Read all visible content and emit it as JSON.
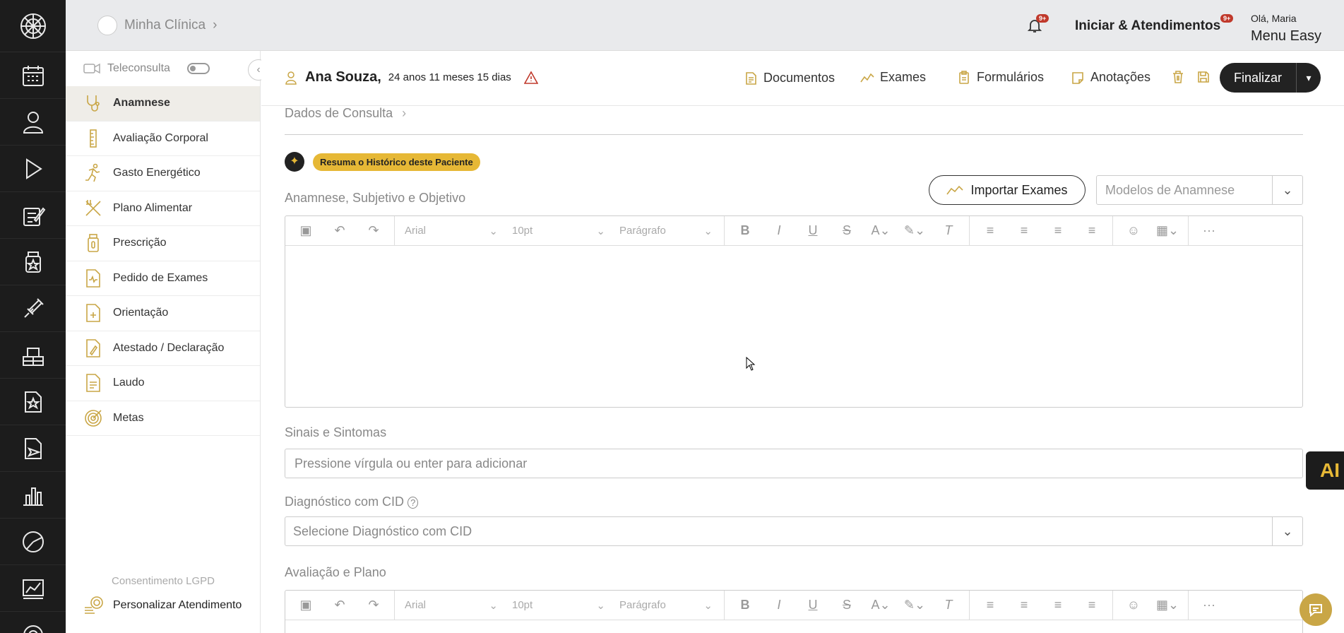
{
  "topbar": {
    "clinic_name": "Minha Clínica",
    "clinic_chevron": "›",
    "notif_badge": "9+",
    "start_label": "Iniciar & Atendimentos",
    "start_badge": "9+",
    "greeting": "Olá, Maria",
    "account_menu": "Menu Easy"
  },
  "rail": [
    "logo-icon",
    "calendar-icon",
    "patient-icon",
    "play-icon",
    "notes-icon",
    "bottle-icon",
    "syringe-icon",
    "boxes-icon",
    "star-document-icon",
    "send-document-icon",
    "chart-bars-icon",
    "chart-pie-icon",
    "finance-chart-icon",
    "settings-icon"
  ],
  "sidebar": {
    "teleconsulta": "Teleconsulta",
    "items": [
      {
        "label": "Anamnese",
        "icon": "stethoscope-icon",
        "active": true
      },
      {
        "label": "Avaliação Corporal",
        "icon": "ruler-icon"
      },
      {
        "label": "Gasto Energético",
        "icon": "running-icon"
      },
      {
        "label": "Plano Alimentar",
        "icon": "utensils-icon"
      },
      {
        "label": "Prescrição",
        "icon": "pill-bottle-icon"
      },
      {
        "label": "Pedido de Exames",
        "icon": "exam-document-icon"
      },
      {
        "label": "Orientação",
        "icon": "plus-document-icon"
      },
      {
        "label": "Atestado / Declaração",
        "icon": "sign-document-icon"
      },
      {
        "label": "Laudo",
        "icon": "report-icon"
      },
      {
        "label": "Metas",
        "icon": "target-icon"
      }
    ],
    "lgpd": "Consentimento LGPD",
    "customize": "Personalizar Atendimento"
  },
  "patient": {
    "name": "Ana Souza,",
    "age": "24 anos 11 meses 15 dias"
  },
  "actions": {
    "documents": "Documentos",
    "exams": "Exames",
    "forms": "Formulários",
    "notes": "Anotações",
    "finalize": "Finalizar"
  },
  "main": {
    "breadcrumb": "Dados de Consulta",
    "breadcrumb_chevron": "›",
    "ai_summary": "Resuma o Histórico deste Paciente",
    "anamnese_label": "Anamnese, Subjetivo e Objetivo",
    "import_exams": "Importar Exames",
    "models_placeholder": "Modelos de Anamnese",
    "symptoms_label": "Sinais e Sintomas",
    "symptoms_placeholder": "Pressione vírgula ou enter para adicionar",
    "cid_label": "Diagnóstico com CID",
    "cid_placeholder": "Selecione Diagnóstico com CID",
    "plan_label": "Avaliação e Plano",
    "toolbar": {
      "font": "Arial",
      "size": "10pt",
      "block": "Parágrafo"
    }
  },
  "ai_float": "AI",
  "colors": {
    "accent": "#c9a646",
    "rail": "#1c1c1c",
    "ai_pill": "#e6b836"
  }
}
